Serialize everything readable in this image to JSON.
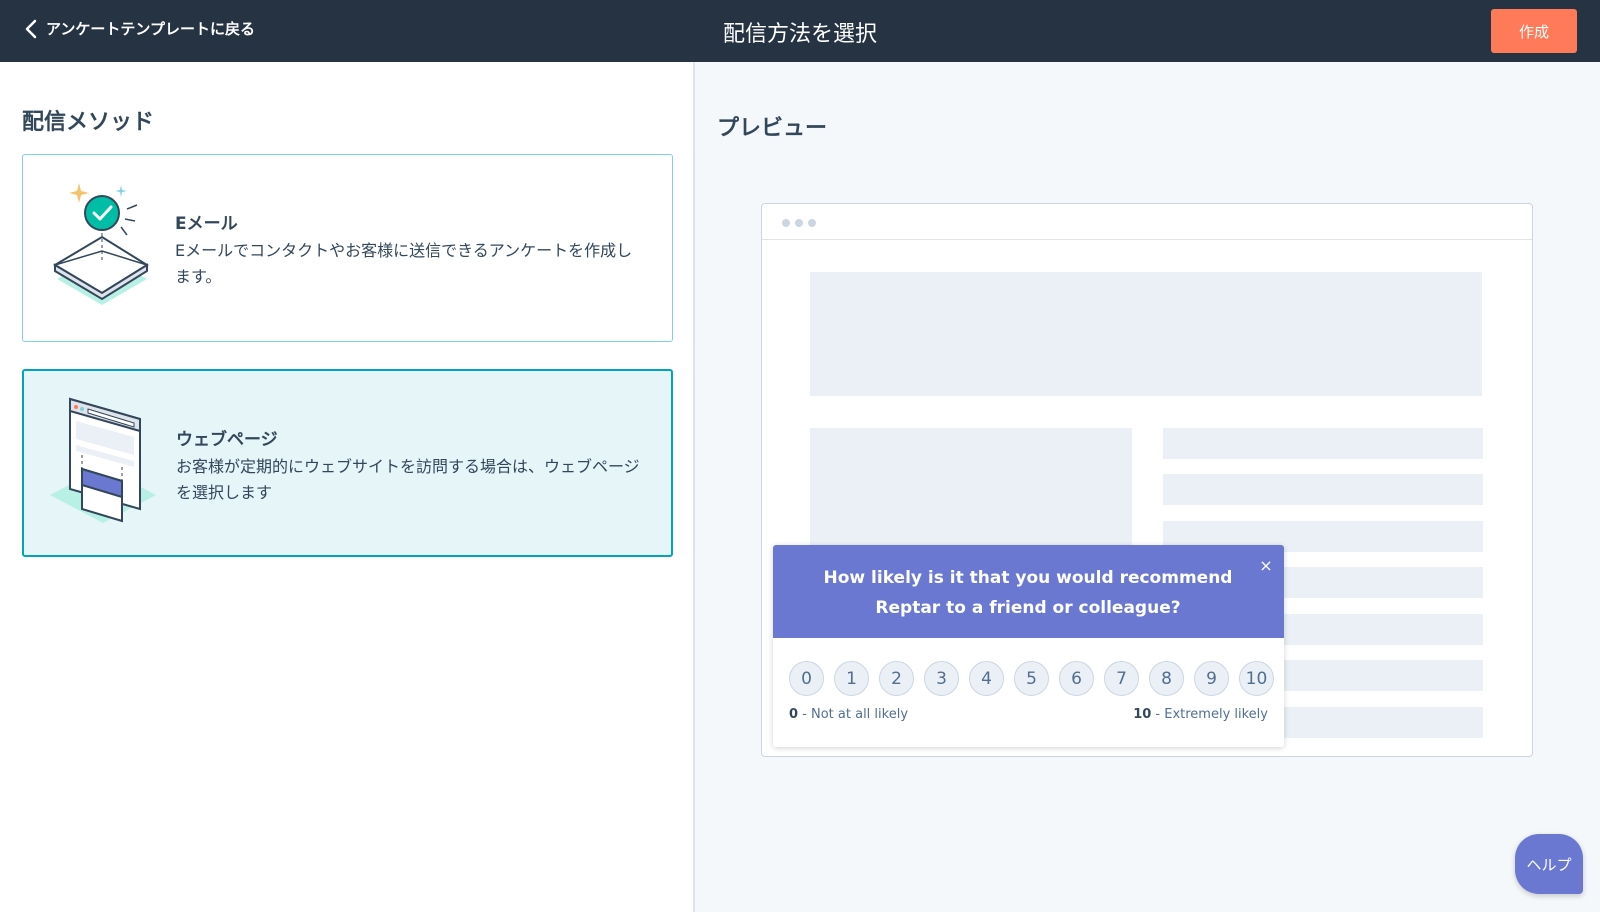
{
  "header": {
    "back_label": "アンケートテンプレートに戻る",
    "title": "配信方法を選択",
    "create_label": "作成"
  },
  "methods": {
    "section_title": "配信メソッド",
    "items": [
      {
        "title": "Eメール",
        "description": "Eメールでコンタクトやお客様に送信できるアンケートを作成します。",
        "selected": false
      },
      {
        "title": "ウェブページ",
        "description": "お客様が定期的にウェブサイトを訪問する場合は、ウェブページを選択します",
        "selected": true
      }
    ]
  },
  "preview": {
    "title": "プレビュー",
    "survey": {
      "question": "How likely is it that you would recommend Reptar to a friend or colleague?",
      "close_symbol": "×",
      "scale": [
        "0",
        "1",
        "2",
        "3",
        "4",
        "5",
        "6",
        "7",
        "8",
        "9",
        "10"
      ],
      "low_value": "0",
      "low_label": " - Not at all likely",
      "high_value": "10",
      "high_label": " - Extremely likely"
    }
  },
  "help": {
    "label": "ヘルプ"
  },
  "colors": {
    "header_bg": "#253342",
    "accent_orange": "#ff7a59",
    "selected_border": "#00a4bd",
    "selected_bg": "#e5f5f8",
    "survey_purple": "#6a78d1"
  },
  "icons": {
    "back": "chevron-left-icon",
    "email": "email-envelope-illustration",
    "web": "webpage-illustration",
    "close": "close-icon"
  }
}
